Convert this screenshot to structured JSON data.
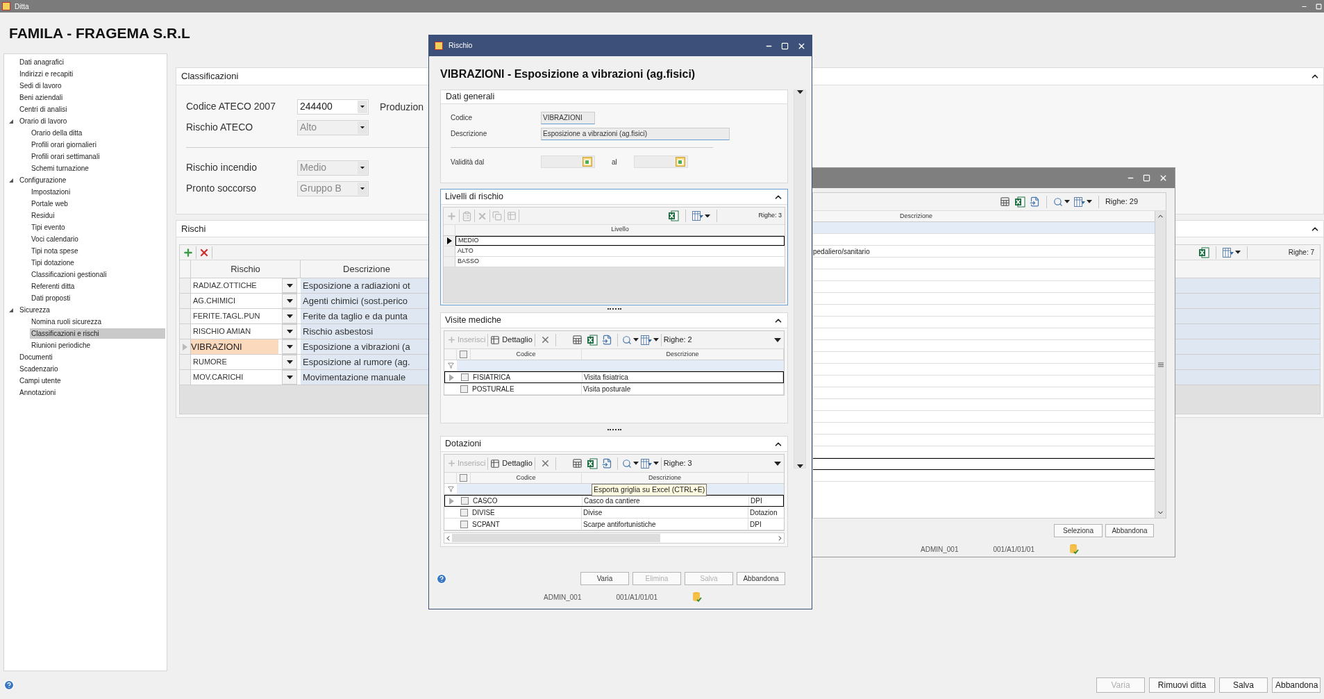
{
  "app_window": {
    "title": "Ditta"
  },
  "company_title": "FAMILA - FRAGEMA S.R.L",
  "sidebar": {
    "items": [
      {
        "label": "Dati anagrafici",
        "selected": false,
        "expanded": false
      },
      {
        "label": "Indirizzi e recapiti",
        "selected": false,
        "expanded": false
      },
      {
        "label": "Sedi di lavoro",
        "selected": false,
        "expanded": false
      },
      {
        "label": "Beni aziendali",
        "selected": false,
        "expanded": false
      },
      {
        "label": "Centri di analisi",
        "selected": false,
        "expanded": false
      },
      {
        "label": "Orario di lavoro",
        "selected": false,
        "expanded": true,
        "children": [
          {
            "label": "Orario della ditta",
            "selected": false
          },
          {
            "label": "Profili orari giornalieri",
            "selected": false
          },
          {
            "label": "Profili orari settimanali",
            "selected": false
          },
          {
            "label": "Schemi turnazione",
            "selected": false
          }
        ]
      },
      {
        "label": "Configurazione",
        "selected": false,
        "expanded": true,
        "children": [
          {
            "label": "Impostazioni",
            "selected": false
          },
          {
            "label": "Portale web",
            "selected": false
          },
          {
            "label": "Residui",
            "selected": false
          },
          {
            "label": "Tipi evento",
            "selected": false
          },
          {
            "label": "Voci calendario",
            "selected": false
          },
          {
            "label": "Tipi nota spese",
            "selected": false
          },
          {
            "label": "Tipi dotazione",
            "selected": false
          },
          {
            "label": "Classificazioni gestionali",
            "selected": false
          },
          {
            "label": "Referenti ditta",
            "selected": false
          },
          {
            "label": "Dati proposti",
            "selected": false
          }
        ]
      },
      {
        "label": "Sicurezza",
        "selected": false,
        "expanded": true,
        "children": [
          {
            "label": "Nomina ruoli sicurezza",
            "selected": false
          },
          {
            "label": "Classificazioni e rischi",
            "selected": true
          },
          {
            "label": "Riunioni periodiche",
            "selected": false
          }
        ]
      },
      {
        "label": "Documenti",
        "selected": false,
        "expanded": false
      },
      {
        "label": "Scadenzario",
        "selected": false,
        "expanded": false
      },
      {
        "label": "Campi utente",
        "selected": false,
        "expanded": false
      },
      {
        "label": "Annotazioni",
        "selected": false,
        "expanded": false
      }
    ]
  },
  "classificazioni": {
    "title": "Classificazioni",
    "ateco_description": "Produzion",
    "fields": [
      {
        "label": "Codice ATECO 2007",
        "value": "244400",
        "disabled": false
      },
      {
        "label": "Rischio ATECO",
        "value": "Alto",
        "disabled": true
      },
      {
        "label": "Rischio incendio",
        "value": "Medio",
        "disabled": true
      },
      {
        "label": "Pronto soccorso",
        "value": "Gruppo B",
        "disabled": true
      }
    ]
  },
  "rischi": {
    "title": "Rischi",
    "row_count": "Righe: 7",
    "columns": [
      "Rischio",
      "Descrizione"
    ],
    "rows": [
      {
        "code": "RADIAZ.OTTICHE",
        "description": "Esposizione a radiazioni ot",
        "selected": false
      },
      {
        "code": "AG.CHIMICI",
        "description": "Agenti chimici (sost.perico",
        "selected": false
      },
      {
        "code": "FERITE.TAGL.PUN",
        "description": "Ferite da taglio e da punta",
        "selected": false
      },
      {
        "code": "RISCHIO AMIAN",
        "description": "Rischio asbestosi",
        "selected": false
      },
      {
        "code": "VIBRAZIONI",
        "description": "Esposizione a vibrazioni (a",
        "selected": true
      },
      {
        "code": "RUMORE",
        "description": "Esposizione al rumore (ag.",
        "selected": false
      },
      {
        "code": "MOV.CARICHI",
        "description": "Movimentazione manuale",
        "selected": false
      }
    ]
  },
  "lookup_window": {
    "row_count": "Righe: 29",
    "column": "Descrizione",
    "visible_text": "pedaliero/sanitario",
    "buttons": [
      "Seleziona",
      "Abbandona"
    ],
    "status": [
      "ADMIN_001",
      "001/A1/01/01"
    ]
  },
  "dialog": {
    "title": "Rischio",
    "heading": "VIBRAZIONI - Esposizione a vibrazioni (ag.fisici)",
    "dati_generali": {
      "title": "Dati generali",
      "fields": [
        {
          "label": "Codice",
          "value": "VIBRAZIONI"
        },
        {
          "label": "Descrizione",
          "value": "Esposizione a vibrazioni (ag.fisici)"
        }
      ],
      "validity_from": "Validità dal",
      "validity_to": "al"
    },
    "livelli": {
      "title": "Livelli di rischio",
      "row_count": "Righe: 3",
      "column": "Livello",
      "rows": [
        {
          "value": "MEDIO",
          "selected": true
        },
        {
          "value": "ALTO",
          "selected": false
        },
        {
          "value": "BASSO",
          "selected": false
        }
      ]
    },
    "visite": {
      "title": "Visite mediche",
      "all_checked": false,
      "insert": "Inserisci",
      "detail": "Dettaglio",
      "row_count": "Righe: 2",
      "columns": [
        "Codice",
        "Descrizione"
      ],
      "rows": [
        {
          "code": "FISIATRICA",
          "description": "Visita fisiatrica",
          "checked": false,
          "selected": true
        },
        {
          "code": "POSTURALE",
          "description": "Visita posturale",
          "checked": false,
          "selected": false
        }
      ]
    },
    "dotazioni": {
      "title": "Dotazioni",
      "all_checked": false,
      "insert": "Inserisci",
      "detail": "Dettaglio",
      "row_count": "Righe: 3",
      "columns": [
        "Codice",
        "Descrizione"
      ],
      "tooltip": "Esporta griglia su Excel (CTRL+E)",
      "rows": [
        {
          "code": "CASCO",
          "description": "Casco da cantiere",
          "type": "DPI",
          "checked": false,
          "selected": true
        },
        {
          "code": "DIVISE",
          "description": "Divise",
          "type": "Dotazion",
          "checked": false,
          "selected": false
        },
        {
          "code": "SCPANT",
          "description": "Scarpe antifortunistiche",
          "type": "DPI",
          "checked": false,
          "selected": false
        }
      ]
    },
    "buttons": [
      {
        "label": "Varia",
        "disabled": false
      },
      {
        "label": "Elimina",
        "disabled": true
      },
      {
        "label": "Salva",
        "disabled": true
      },
      {
        "label": "Abbandona",
        "disabled": false
      }
    ],
    "status": [
      "ADMIN_001",
      "001/A1/01/01"
    ]
  },
  "footer_buttons": [
    {
      "label": "Varia",
      "disabled": true
    },
    {
      "label": "Rimuovi ditta",
      "disabled": false
    },
    {
      "label": "Salva",
      "disabled": false
    },
    {
      "label": "Abbandona",
      "disabled": false
    }
  ]
}
